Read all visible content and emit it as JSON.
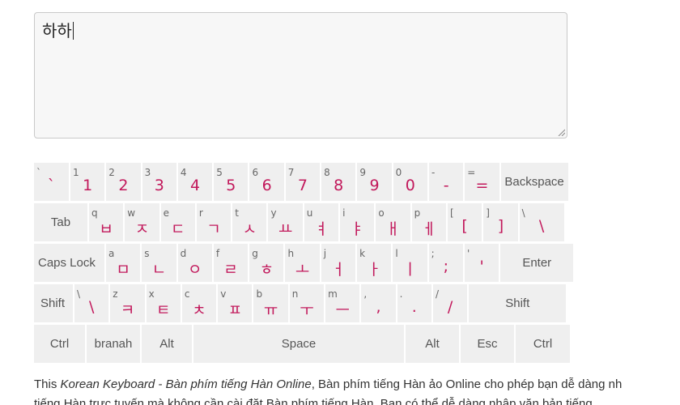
{
  "editor": {
    "value": "하하"
  },
  "keyboard": {
    "row1": [
      {
        "shift": "`",
        "main": "`"
      },
      {
        "shift": "1",
        "main": "1"
      },
      {
        "shift": "2",
        "main": "2"
      },
      {
        "shift": "3",
        "main": "3"
      },
      {
        "shift": "4",
        "main": "4"
      },
      {
        "shift": "5",
        "main": "5"
      },
      {
        "shift": "6",
        "main": "6"
      },
      {
        "shift": "7",
        "main": "7"
      },
      {
        "shift": "8",
        "main": "8"
      },
      {
        "shift": "9",
        "main": "9"
      },
      {
        "shift": "0",
        "main": "0"
      },
      {
        "shift": "-",
        "main": "-"
      },
      {
        "shift": "=",
        "main": "="
      }
    ],
    "row2": [
      {
        "shift": "q",
        "main": "ㅂ"
      },
      {
        "shift": "w",
        "main": "ㅈ"
      },
      {
        "shift": "e",
        "main": "ㄷ"
      },
      {
        "shift": "r",
        "main": "ㄱ"
      },
      {
        "shift": "t",
        "main": "ㅅ"
      },
      {
        "shift": "y",
        "main": "ㅛ"
      },
      {
        "shift": "u",
        "main": "ㅕ"
      },
      {
        "shift": "i",
        "main": "ㅑ"
      },
      {
        "shift": "o",
        "main": "ㅐ"
      },
      {
        "shift": "p",
        "main": "ㅔ"
      },
      {
        "shift": "[",
        "main": "["
      },
      {
        "shift": "]",
        "main": "]"
      },
      {
        "shift": "\\",
        "main": "\\"
      }
    ],
    "row3": [
      {
        "shift": "a",
        "main": "ㅁ"
      },
      {
        "shift": "s",
        "main": "ㄴ"
      },
      {
        "shift": "d",
        "main": "ㅇ"
      },
      {
        "shift": "f",
        "main": "ㄹ"
      },
      {
        "shift": "g",
        "main": "ㅎ"
      },
      {
        "shift": "h",
        "main": "ㅗ"
      },
      {
        "shift": "j",
        "main": "ㅓ"
      },
      {
        "shift": "k",
        "main": "ㅏ"
      },
      {
        "shift": "l",
        "main": "ㅣ"
      },
      {
        "shift": ";",
        "main": ";"
      },
      {
        "shift": "'",
        "main": "'"
      }
    ],
    "row4": [
      {
        "shift": "\\",
        "main": "\\"
      },
      {
        "shift": "z",
        "main": "ㅋ"
      },
      {
        "shift": "x",
        "main": "ㅌ"
      },
      {
        "shift": "c",
        "main": "ㅊ"
      },
      {
        "shift": "v",
        "main": "ㅍ"
      },
      {
        "shift": "b",
        "main": "ㅠ"
      },
      {
        "shift": "n",
        "main": "ㅜ"
      },
      {
        "shift": "m",
        "main": "ㅡ"
      },
      {
        "shift": ",",
        "main": ","
      },
      {
        "shift": ".",
        "main": "."
      },
      {
        "shift": "/",
        "main": "/"
      }
    ],
    "labels": {
      "backspace": "Backspace",
      "tab": "Tab",
      "caps_lock": "Caps Lock",
      "enter": "Enter",
      "shift_left": "Shift",
      "shift_right": "Shift",
      "ctrl_left": "Ctrl",
      "branah": "branah",
      "alt_left": "Alt",
      "space": "Space",
      "alt_right": "Alt",
      "esc": "Esc",
      "ctrl_right": "Ctrl"
    }
  },
  "description": {
    "lead": "This ",
    "title_italic": "Korean Keyboard - Bàn phím tiếng Hàn Online",
    "rest": ", Bàn phím tiếng Hàn ảo Online cho phép bạn dễ dàng nh",
    "line2": "tiếng Hàn trực tuyến mà không cần cài đặt Bàn phím tiếng Hàn. Bạn có thể dễ dàng nhập văn bản tiếng"
  },
  "colors": {
    "accent": "#c2185b",
    "key_bg": "#efefef"
  }
}
